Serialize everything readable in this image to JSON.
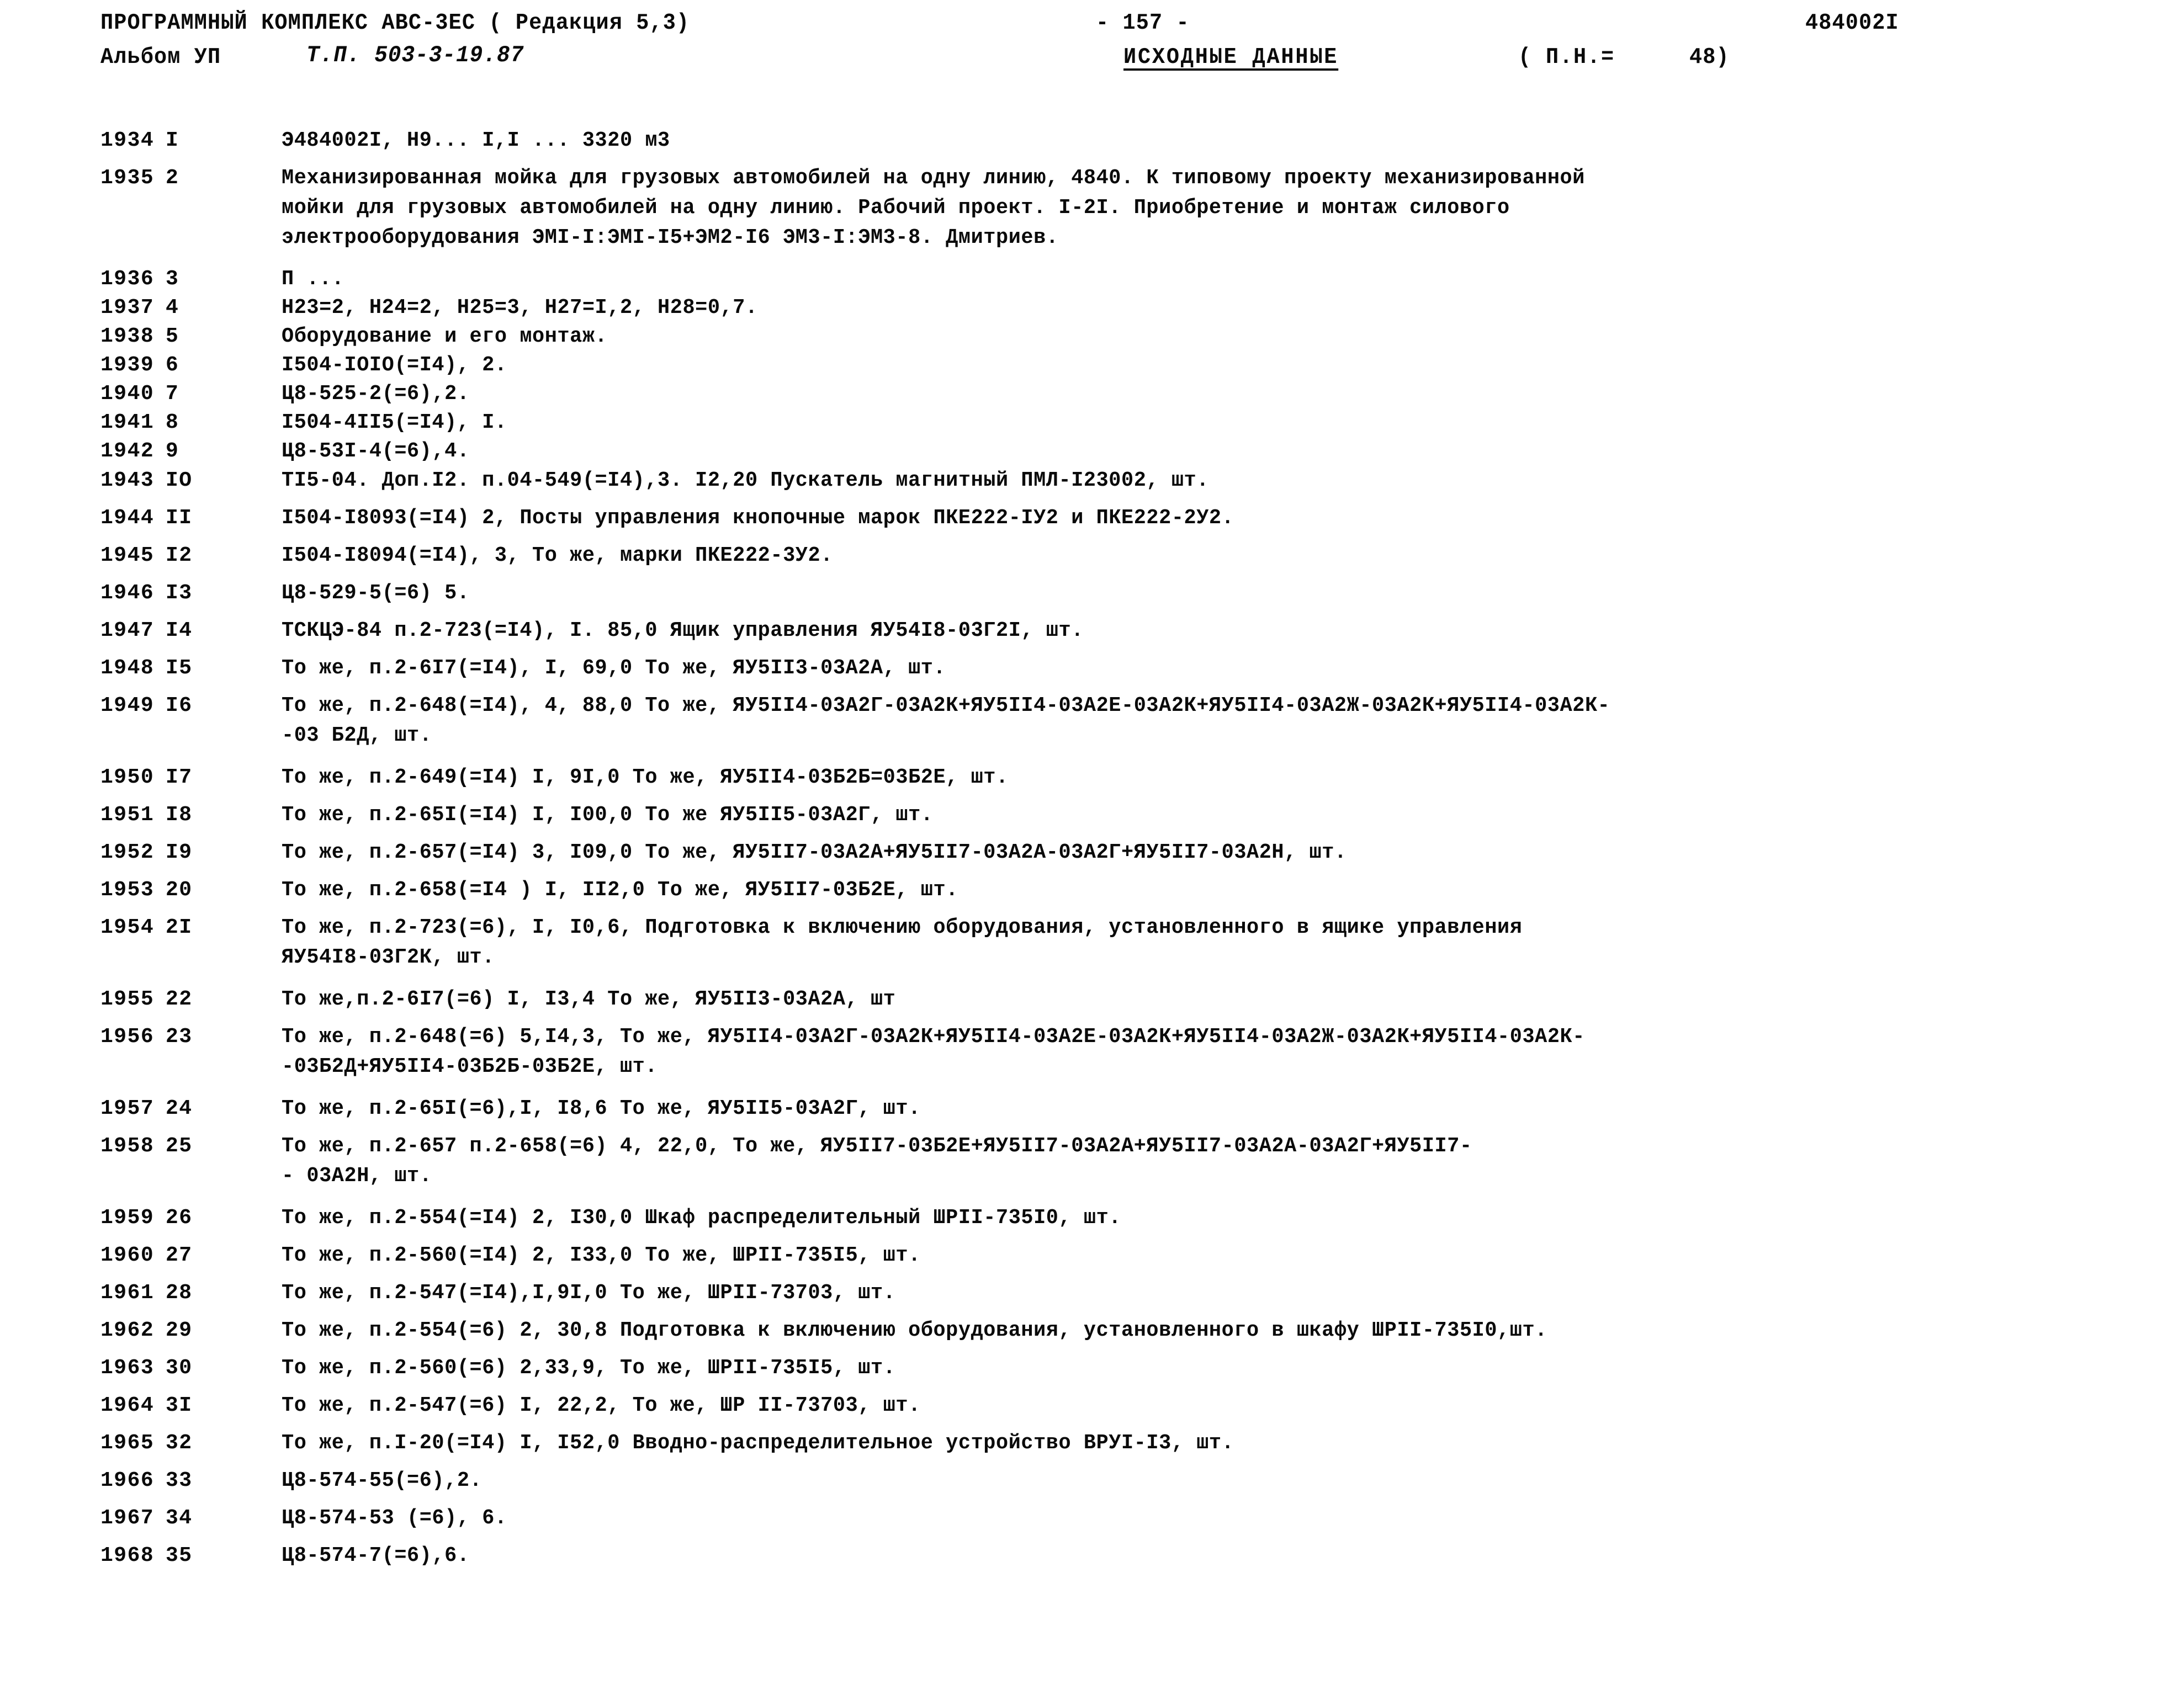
{
  "header": {
    "program_title": "ПРОГРАММНЫЙ КОМПЛЕКС АВС-3ЕС ( Редакция 5,3)",
    "album_label": "Альбом УП",
    "typical_project": "Т.П. 503-3-19.87",
    "page_number": "- 157 -",
    "section_title": "ИСХОДНЫЕ  ДАННЫЕ",
    "pn_label": "( П.Н.=",
    "pn_value": "48)",
    "doc_code": "484002I"
  },
  "rows": [
    {
      "code": "1934",
      "num": "I",
      "lines": [
        "Э484002I, Н9... I,I ... 3320 м3"
      ]
    },
    {
      "code": "1935",
      "num": "2",
      "lines": [
        "Механизированная мойка для грузовых автомобилей на одну линию, 4840. К типовому проекту механизированной",
        "мойки для грузовых автомобилей на одну линию. Рабочий проект. I-2I. Приобретение и монтаж силового",
        "электрооборудования ЭМI-I:ЭМI-I5+ЭМ2-I6  ЭМ3-I:ЭМ3-8.  Дмитриев."
      ]
    },
    {
      "code": "1936",
      "num": "3",
      "lines": [
        "П ..."
      ]
    },
    {
      "code": "1937",
      "num": "4",
      "lines": [
        "Н23=2,  Н24=2, Н25=3, Н27=I,2, Н28=0,7."
      ]
    },
    {
      "code": "1938",
      "num": "5",
      "lines": [
        "Оборудование и его монтаж."
      ]
    },
    {
      "code": "1939",
      "num": "6",
      "lines": [
        "I504-IOIO(=I4), 2."
      ]
    },
    {
      "code": "1940",
      "num": "7",
      "lines": [
        "Ц8-525-2(=6),2."
      ]
    },
    {
      "code": "1941",
      "num": "8",
      "lines": [
        "I504-4II5(=I4), I."
      ]
    },
    {
      "code": "1942",
      "num": "9",
      "lines": [
        "Ц8-53I-4(=6),4."
      ]
    },
    {
      "code": "1943",
      "num": "IO",
      "lines": [
        "ТI5-04. Доп.I2. п.04-549(=I4),3. I2,20  Пускатель магнитный ПМЛ-I23002, шт."
      ]
    },
    {
      "code": "1944",
      "num": "II",
      "lines": [
        "I504-I8093(=I4) 2,  Посты управления кнопочные марок ПКЕ222-IУ2 и ПКЕ222-2У2."
      ]
    },
    {
      "code": "1945",
      "num": "I2",
      "lines": [
        "I504-I8094(=I4), 3, То же, марки ПКЕ222-3У2."
      ]
    },
    {
      "code": "1946",
      "num": "I3",
      "lines": [
        "Ц8-529-5(=6) 5."
      ]
    },
    {
      "code": "1947",
      "num": "I4",
      "lines": [
        "ТСКЦЭ-84 п.2-723(=I4), I. 85,0  Ящик управления ЯУ54I8-03Г2I, шт."
      ]
    },
    {
      "code": "1948",
      "num": "I5",
      "lines": [
        "То же, п.2-6I7(=I4), I, 69,0  То же, ЯУ5II3-03А2А, шт."
      ]
    },
    {
      "code": "1949",
      "num": "I6",
      "lines": [
        "То же, п.2-648(=I4), 4, 88,0  То же, ЯУ5II4-03А2Г-03А2К+ЯУ5II4-03А2Е-03А2К+ЯУ5II4-03А2Ж-03А2К+ЯУ5II4-03А2К-",
        "-03 Б2Д, шт."
      ]
    },
    {
      "code": "1950",
      "num": "I7",
      "lines": [
        "То же, п.2-649(=I4) I, 9I,0  То же, ЯУ5II4-03Б2Б=03Б2Е, шт."
      ]
    },
    {
      "code": "1951",
      "num": "I8",
      "lines": [
        "То же, п.2-65I(=I4) I, I00,0 То же ЯУ5II5-03А2Г, шт."
      ]
    },
    {
      "code": "1952",
      "num": "I9",
      "lines": [
        "То же, п.2-657(=I4) 3, I09,0  То же, ЯУ5II7-03А2А+ЯУ5II7-03А2А-03А2Г+ЯУ5II7-03А2Н, шт."
      ]
    },
    {
      "code": "1953",
      "num": "20",
      "lines": [
        "То же, п.2-658(=I4 ) I, II2,0 То же, ЯУ5II7-03Б2Е, шт."
      ]
    },
    {
      "code": "1954",
      "num": "2I",
      "lines": [
        "То же, п.2-723(=6), I, I0,6, Подготовка к включению оборудования, установленного в ящике управления",
        "ЯУ54I8-03Г2К, шт."
      ]
    },
    {
      "code": "1955",
      "num": "22",
      "lines": [
        "То же,п.2-6I7(=6) I, I3,4 То же,  ЯУ5II3-03А2А, шт"
      ]
    },
    {
      "code": "1956",
      "num": "23",
      "lines": [
        "То же, п.2-648(=6) 5,I4,3, То же,   ЯУ5II4-03А2Г-03А2К+ЯУ5II4-03А2Е-03А2К+ЯУ5II4-03А2Ж-03А2К+ЯУ5II4-03А2К-",
        "-03Б2Д+ЯУ5II4-03Б2Б-03Б2Е, шт."
      ]
    },
    {
      "code": "1957",
      "num": "24",
      "lines": [
        "То же, п.2-65I(=6),I, I8,6  То же,  ЯУ5II5-03А2Г, шт."
      ]
    },
    {
      "code": "1958",
      "num": "25",
      "lines": [
        "То же, п.2-657 п.2-658(=6)  4, 22,0, То же,  ЯУ5II7-03Б2Е+ЯУ5II7-03А2А+ЯУ5II7-03А2А-03А2Г+ЯУ5II7-",
        "- 03А2Н, шт."
      ]
    },
    {
      "code": "1959",
      "num": "26",
      "lines": [
        "То же, п.2-554(=I4) 2, I30,0  Шкаф распределительный ШРII-735I0, шт."
      ]
    },
    {
      "code": "1960",
      "num": "27",
      "lines": [
        "То же, п.2-560(=I4) 2, I33,0 То же, ШРII-735I5, шт."
      ]
    },
    {
      "code": "1961",
      "num": "28",
      "lines": [
        "То же, п.2-547(=I4),I,9I,0 То же, ШРII-73703,  шт."
      ]
    },
    {
      "code": "1962",
      "num": "29",
      "lines": [
        "То же, п.2-554(=6) 2, 30,8 Подготовка к включению оборудования, установленного в шкафу ШРII-735I0,шт."
      ]
    },
    {
      "code": "1963",
      "num": "30",
      "lines": [
        "То же, п.2-560(=6) 2,33,9, То же,   ШРII-735I5, шт."
      ]
    },
    {
      "code": "1964",
      "num": "3I",
      "lines": [
        "То же, п.2-547(=6) I, 22,2, То же,  ШР II-73703, шт."
      ]
    },
    {
      "code": "1965",
      "num": "32",
      "lines": [
        "То же, п.I-20(=I4) I, I52,0  Вводно-распределительное устройство ВРУI-I3, шт."
      ]
    },
    {
      "code": "1966",
      "num": "33",
      "lines": [
        "Ц8-574-55(=6),2."
      ]
    },
    {
      "code": "1967",
      "num": "34",
      "lines": [
        "Ц8-574-53 (=6), 6."
      ]
    },
    {
      "code": "1968",
      "num": "35",
      "lines": [
        "Ц8-574-7(=6),6."
      ]
    }
  ]
}
